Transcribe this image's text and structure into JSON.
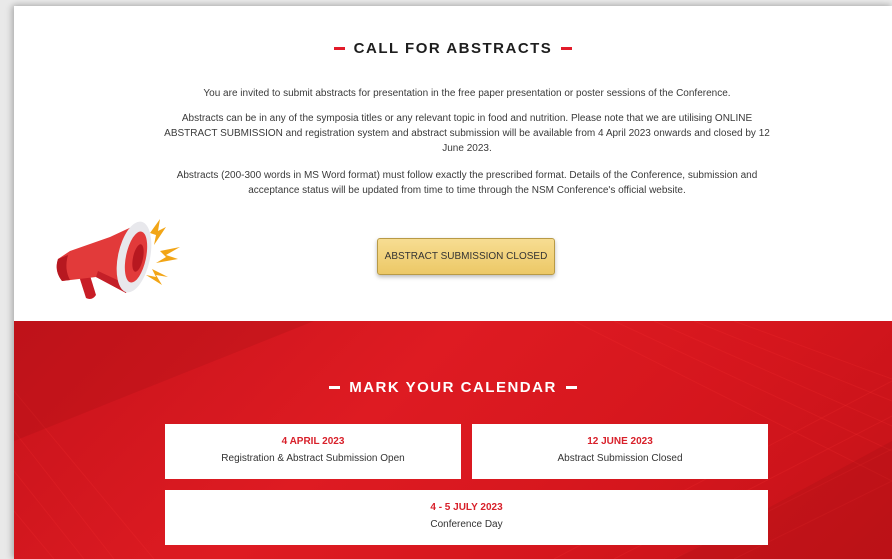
{
  "call_for_abstracts": {
    "title": "CALL FOR ABSTRACTS",
    "paragraphs": [
      "You are invited to submit abstracts for presentation in the free paper presentation or poster sessions of the Conference.",
      "Abstracts can be in any of the symposia titles or any relevant topic in food and nutrition. Please note that we are utilising ONLINE ABSTRACT SUBMISSION and registration system and abstract submission will be available from 4 April 2023 onwards and closed by 12 June 2023.",
      "Abstracts (200-300 words in MS Word format) must follow exactly the prescribed format. Details of the Conference, submission and acceptance status will be updated from time to time through the NSM Conference's official website."
    ],
    "button_label": "ABSTRACT SUBMISSION CLOSED",
    "illustration_icon": "megaphone-icon"
  },
  "calendar": {
    "title": "MARK YOUR CALENDAR",
    "events": [
      {
        "date": "4 APRIL 2023",
        "description": "Registration & Abstract Submission Open"
      },
      {
        "date": "12 JUNE 2023",
        "description": "Abstract Submission Closed"
      },
      {
        "date": "4 - 5 JULY 2023",
        "description": "Conference Day"
      }
    ]
  },
  "colors": {
    "accent_red": "#e21b2a",
    "date_red": "#d8202a",
    "button_gold": "#f2d27a",
    "calendar_bg": "#d5161d"
  }
}
